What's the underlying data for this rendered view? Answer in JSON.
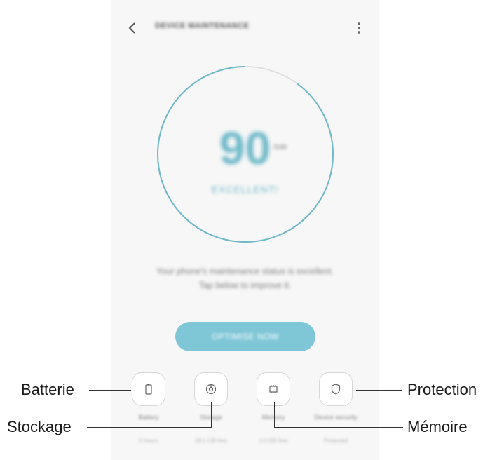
{
  "app": {
    "title": "DEVICE MAINTENANCE"
  },
  "score": {
    "value": "90",
    "max": "/100",
    "status": "EXCELLENT!",
    "ring_fraction": 0.9,
    "accent_color": "#6fb9c9"
  },
  "message": {
    "line1": "Your phone's maintenance status is excellent.",
    "line2": "Tap below to improve it."
  },
  "optimize_button": {
    "label": "OPTIMISE NOW"
  },
  "tiles": [
    {
      "icon": "battery-icon",
      "label": "Battery",
      "sub": "5 hours"
    },
    {
      "icon": "storage-icon",
      "label": "Storage",
      "sub": "28.1 GB free"
    },
    {
      "icon": "memory-icon",
      "label": "Memory",
      "sub": "2.0 GB free"
    },
    {
      "icon": "shield-icon",
      "label": "Device security",
      "sub": "Protected"
    }
  ],
  "callouts": {
    "battery": "Batterie",
    "storage": "Stockage",
    "memory": "Mémoire",
    "security": "Protection"
  }
}
